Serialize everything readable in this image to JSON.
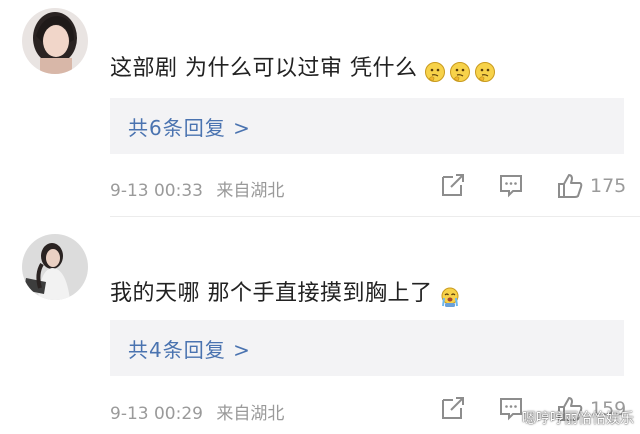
{
  "comments": [
    {
      "text": "这部剧 为什么可以过审 凭什么",
      "reply_link": "共6条回复 >",
      "timestamp": "9-13 00:33",
      "source": "来自湖北",
      "like_count": "175",
      "emojis": [
        "thinking-face",
        "thinking-face",
        "thinking-face"
      ]
    },
    {
      "text": "我的天哪 那个手直接摸到胸上了",
      "reply_link": "共4条回复 >",
      "timestamp": "9-13 00:29",
      "source": "来自湖北",
      "like_count": "159",
      "emojis": [
        "crying-face"
      ]
    }
  ],
  "watermark": "嗯哼哼丽怡怡娱乐",
  "colors": {
    "link": "#4a73b0",
    "meta": "#9a9a9a",
    "reply_bg": "#f3f3f5",
    "text": "#222222"
  },
  "icons": [
    "share-icon",
    "comment-icon",
    "like-icon"
  ]
}
